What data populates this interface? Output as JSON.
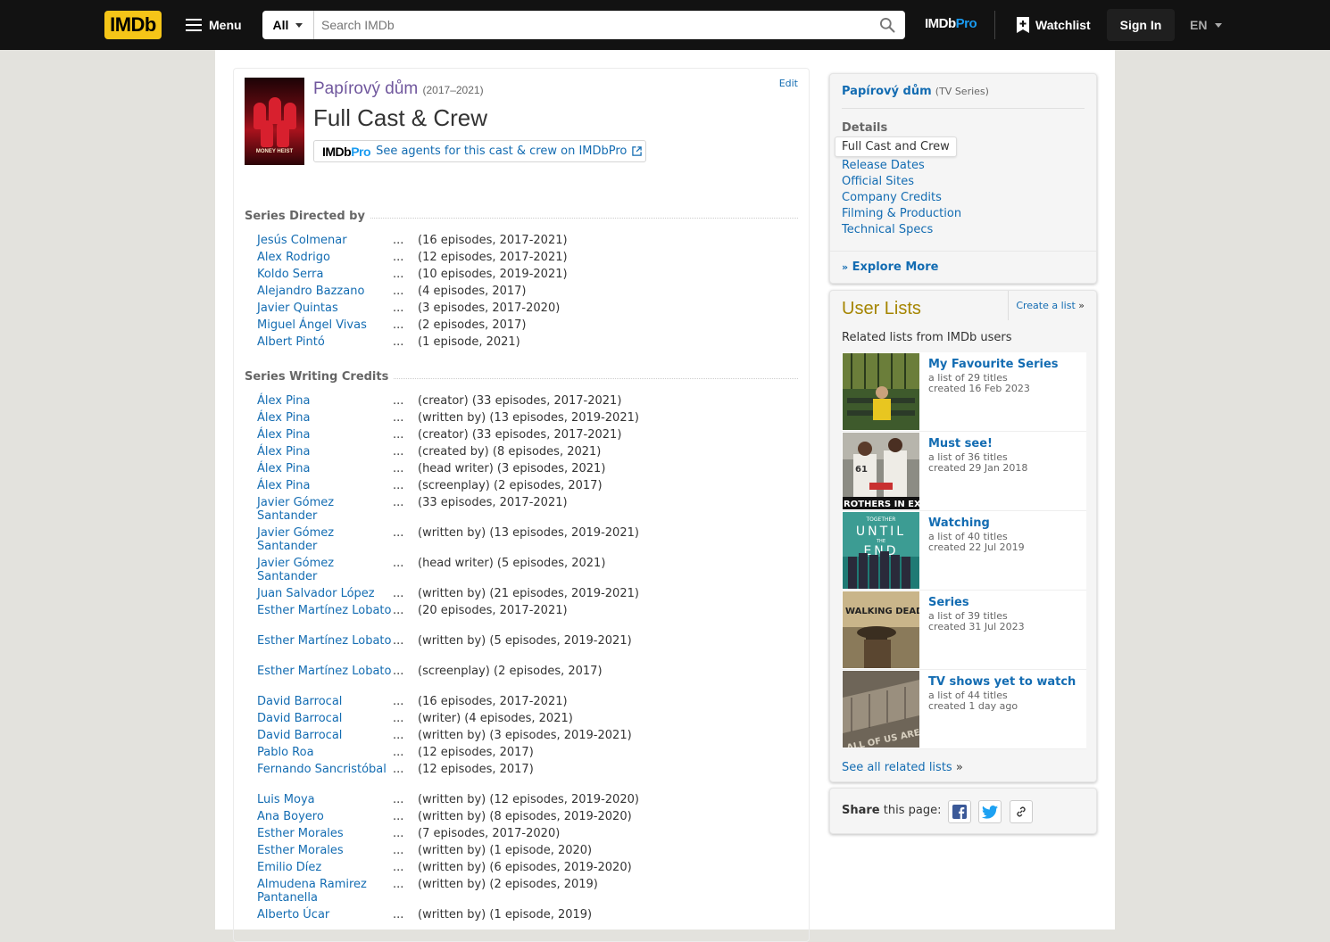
{
  "nav": {
    "logo": "IMDb",
    "menu_label": "Menu",
    "search_category": "All",
    "search_placeholder": "Search IMDb",
    "imdbpro_part1": "IMDb",
    "imdbpro_part2": "Pro",
    "watchlist_label": "Watchlist",
    "signin_label": "Sign In",
    "language": "EN"
  },
  "title": {
    "parent_name": "Papírový dům",
    "years": "(2017–2021)",
    "edit_label": "Edit",
    "page_heading": "Full Cast & Crew",
    "poster_caption": "MONEY HEIST",
    "pro_logo_part1": "IMDb",
    "pro_logo_part2": "Pro",
    "pro_banner_text": "See agents for this cast & crew on IMDbPro"
  },
  "directed": {
    "heading": "Series Directed by",
    "rows": [
      {
        "name": "Jesús Colmenar",
        "credit": "(16 episodes, 2017-2021)"
      },
      {
        "name": "Alex Rodrigo",
        "credit": "(12 episodes, 2017-2021)"
      },
      {
        "name": "Koldo Serra",
        "credit": "(10 episodes, 2019-2021)"
      },
      {
        "name": "Alejandro Bazzano",
        "credit": "(4 episodes, 2017)"
      },
      {
        "name": "Javier Quintas",
        "credit": "(3 episodes, 2017-2020)"
      },
      {
        "name": "Miguel Ángel Vivas",
        "credit": "(2 episodes, 2017)"
      },
      {
        "name": "Albert Pintó",
        "credit": "(1 episode, 2021)"
      }
    ]
  },
  "writing": {
    "heading": "Series Writing Credits",
    "rows": [
      {
        "name": "Álex Pina",
        "credit": "(creator) (33 episodes, 2017-2021)"
      },
      {
        "name": "Álex Pina",
        "credit": "(written by) (13 episodes, 2019-2021)"
      },
      {
        "name": "Álex Pina",
        "credit": "(creator) (33 episodes, 2017-2021)"
      },
      {
        "name": "Álex Pina",
        "credit": "(created by) (8 episodes, 2021)"
      },
      {
        "name": "Álex Pina",
        "credit": "(head writer) (3 episodes, 2021)"
      },
      {
        "name": "Álex Pina",
        "credit": "(screenplay) (2 episodes, 2017)"
      },
      {
        "name": "Javier Gómez Santander",
        "credit": "(33 episodes, 2017-2021)"
      },
      {
        "name": "Javier Gómez Santander",
        "credit": "(written by) (13 episodes, 2019-2021)"
      },
      {
        "name": "Javier Gómez Santander",
        "credit": "(head writer) (5 episodes, 2021)"
      },
      {
        "name": "Juan Salvador López",
        "credit": "(written by) (21 episodes, 2019-2021)"
      },
      {
        "name": "Esther Martínez Lobato",
        "credit": "(20 episodes, 2017-2021)"
      },
      {
        "name": "Esther Martínez Lobato",
        "credit": "(written by) (5 episodes, 2019-2021)"
      },
      {
        "name": "Esther Martínez Lobato",
        "credit": "(screenplay) (2 episodes, 2017)"
      },
      {
        "name": "David Barrocal",
        "credit": "(16 episodes, 2017-2021)"
      },
      {
        "name": "David Barrocal",
        "credit": "(writer) (4 episodes, 2021)"
      },
      {
        "name": "David Barrocal",
        "credit": "(written by) (3 episodes, 2019-2021)"
      },
      {
        "name": "Pablo Roa",
        "credit": "(12 episodes, 2017)"
      },
      {
        "name": "Fernando Sancristóbal",
        "credit": "(12 episodes, 2017)"
      },
      {
        "name": "Luis Moya",
        "credit": "(written by) (12 episodes, 2019-2020)"
      },
      {
        "name": "Ana Boyero",
        "credit": "(written by) (8 episodes, 2019-2020)"
      },
      {
        "name": "Esther Morales",
        "credit": "(7 episodes, 2017-2020)"
      },
      {
        "name": "Esther Morales",
        "credit": "(written by) (1 episode, 2020)"
      },
      {
        "name": "Emilio Díez",
        "credit": "(written by) (6 episodes, 2019-2020)"
      },
      {
        "name": "Almudena Ramirez Pantanella",
        "credit": "(written by) (2 episodes, 2019)"
      },
      {
        "name": "Alberto Úcar",
        "credit": "(written by) (1 episode, 2019)"
      }
    ]
  },
  "sidebar": {
    "series_name": "Papírový dům",
    "series_type": "(TV Series)",
    "details_heading": "Details",
    "details_links": [
      "Full Cast and Crew",
      "Release Dates",
      "Official Sites",
      "Company Credits",
      "Filming & Production",
      "Technical Specs"
    ],
    "explore_more": "Explore More"
  },
  "user_lists": {
    "heading": "User Lists",
    "create_label": "Create a list",
    "create_suffix": "»",
    "subheading": "Related lists from IMDb users",
    "lists": [
      {
        "title": "My Favourite Series",
        "count": "a list of 29 titles",
        "created": "created 16 Feb 2023"
      },
      {
        "title": "Must see!",
        "count": "a list of 36 titles",
        "created": "created 29 Jan 2018"
      },
      {
        "title": "Watching",
        "count": "a list of 40 titles",
        "created": "created 22 Jul 2019"
      },
      {
        "title": "Series",
        "count": "a list of 39 titles",
        "created": "created 31 Jul 2023"
      },
      {
        "title": "TV shows yet to watch",
        "count": "a list of 44 titles",
        "created": "created 1 day ago"
      }
    ],
    "thumb_texts": {
      "must_see": "ROTHERS IN EXIL",
      "watching_top": "TOGETHER",
      "watching_mid": "UNTIL",
      "watching_small": "THE",
      "watching_bottom": "END",
      "series": "WALKING DEAD",
      "yet_to_watch": "ALL OF US ARE DEAD"
    },
    "see_all": "See all related lists",
    "see_all_suffix": "»"
  },
  "share": {
    "bold": "Share",
    "rest": "this page:"
  },
  "colors": {
    "nav_bg": "#121212",
    "imdb_yellow": "#f5c518",
    "link_blue": "#136cb2",
    "parent_title_purple": "#70579d",
    "user_lists_gold": "#a58500",
    "page_bg": "#e3e2dd"
  }
}
